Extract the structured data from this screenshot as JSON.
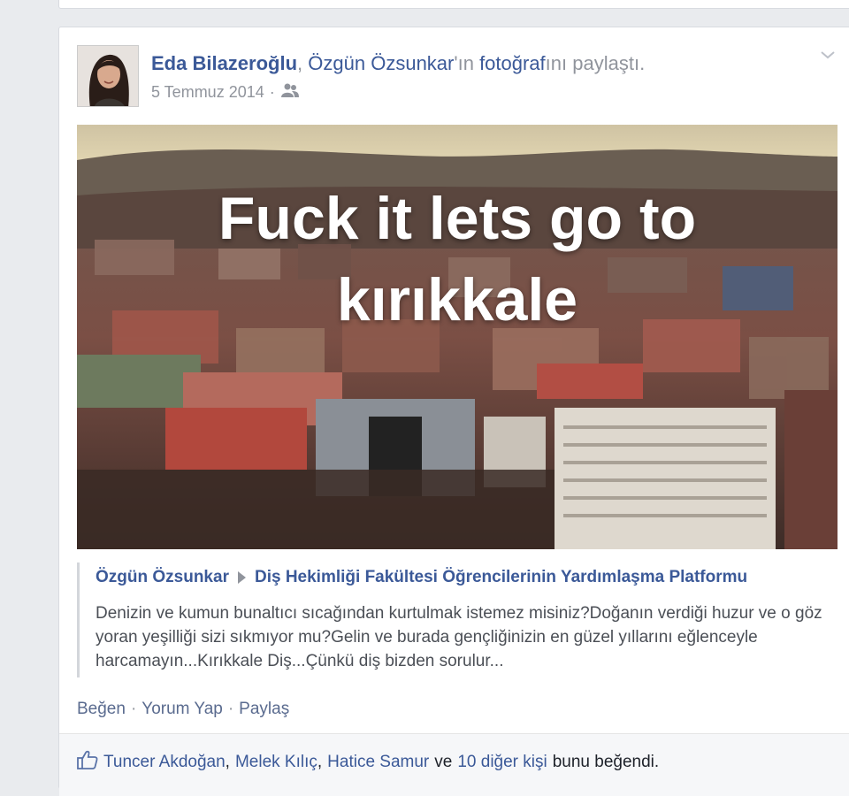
{
  "post": {
    "author": "Eda Bilazeroğlu",
    "separator": ",",
    "shared_owner": "Özgün Özsunkar",
    "shared_suffix_1": "'ın",
    "photo_link": "fotoğraf",
    "shared_suffix_2": "ını paylaştı.",
    "date": "5 Temmuz 2014",
    "dot": "·",
    "audience_icon": "friends-icon",
    "photo_caption_line1": "Fuck it lets go to",
    "photo_caption_line2": "kırıkkale"
  },
  "attachment": {
    "poster": "Özgün Özsunkar",
    "arrow_icon": "triangle-right-icon",
    "group": "Diş Hekimliği Fakültesi Öğrencilerinin Yardımlaşma Platformu",
    "text": "Denizin ve kumun bunaltıcı sıcağından kurtulmak istemez misiniz?Doğanın verdiği huzur ve o göz yoran yeşilliği sizi sıkmıyor mu?Gelin ve burada gençliğinizin en güzel yıllarını eğlenceyle harcamayın...Kırıkkale Diş...Çünkü diş bizden sorulur..."
  },
  "actions": {
    "like": "Beğen",
    "comment": "Yorum Yap",
    "share": "Paylaş",
    "dot": "·"
  },
  "likes": {
    "icon": "thumbs-up-icon",
    "name1": "Tuncer Akdoğan",
    "comma1": ",",
    "name2": "Melek Kılıç",
    "comma2": ",",
    "name3": "Hatice Samur",
    "and": "ve",
    "others": "10 diğer kişi",
    "suffix": "bunu beğendi."
  },
  "colors": {
    "link": "#3b5998",
    "text": "#4b4f56",
    "muted": "#90949c",
    "background": "#e9ebee"
  }
}
